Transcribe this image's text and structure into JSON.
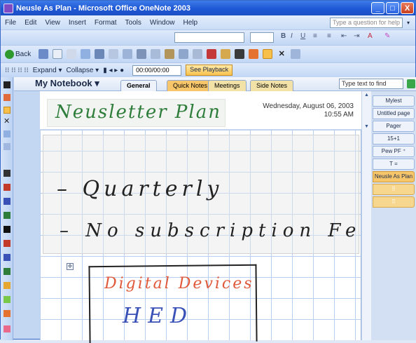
{
  "window": {
    "title": "Neusle As Plan - Microsoft Office OneNote 2003",
    "minimize": "_",
    "maximize": "□",
    "close": "X"
  },
  "menubar": {
    "items": [
      "File",
      "Edit",
      "View",
      "Insert",
      "Format",
      "Tools",
      "Window",
      "Help"
    ],
    "help_placeholder": "Type a question for help",
    "help_arrow": "▾"
  },
  "stdbar": {
    "back_label": "Back"
  },
  "audbar": {
    "expand_label": "Expand ▾",
    "collapse_label": "Collapse ▾",
    "time_value": "00:00/00:00",
    "playback_label": "See Playback"
  },
  "notebook": {
    "title": "My Notebook",
    "tabs": [
      "General",
      "Quick Notes",
      "Meetings",
      "Side Notes"
    ],
    "find_placeholder": "Type text to find"
  },
  "page": {
    "title_ink": "Neusletter Plan",
    "date": "Wednesday, August 06, 2003",
    "time": "10:55 AM",
    "ink_lines": [
      "– Quarterly",
      "– No subscription Fee"
    ],
    "box_ink_red": "Digital Devices",
    "box_ink_blue": "HED"
  },
  "page_tabs": [
    {
      "label": "Mylest",
      "active": false
    },
    {
      "label": "Untitled page",
      "active": false
    },
    {
      "label": "Pager",
      "active": false
    },
    {
      "label": "15+1",
      "active": false
    },
    {
      "label": "Pew PF ⁺",
      "active": false
    },
    {
      "label": "T =",
      "active": false
    },
    {
      "label": "Neusle As Plan",
      "active": true
    }
  ],
  "colors": {
    "accent": "#1f58d6",
    "active_tab": "#f7c66a",
    "grid": "#b9cff0"
  }
}
